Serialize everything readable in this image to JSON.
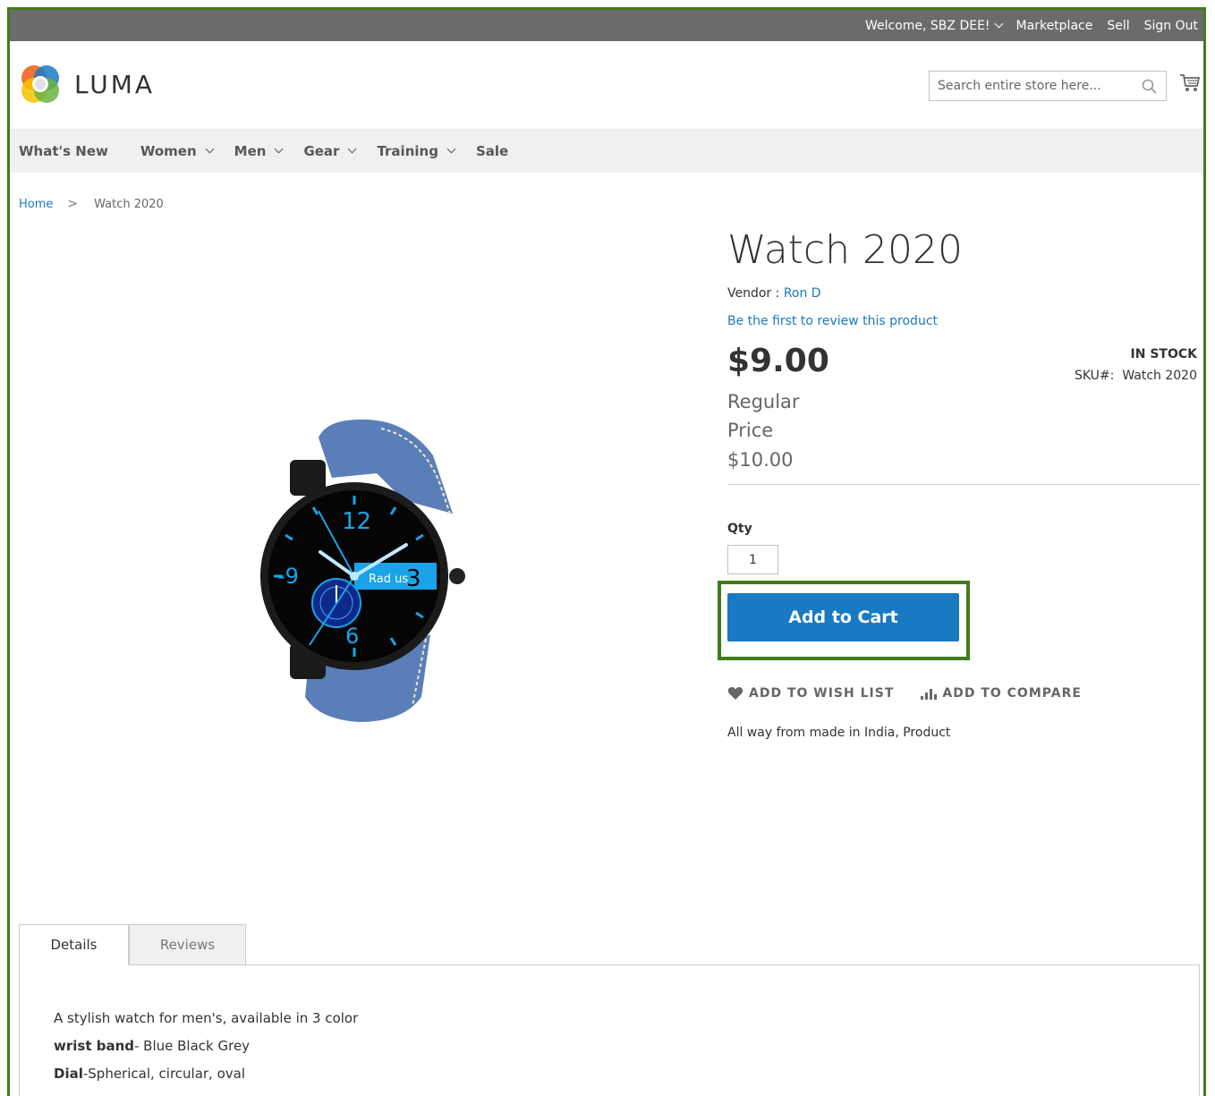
{
  "topbar": {
    "welcome": "Welcome, SBZ DEE!",
    "marketplace": "Marketplace",
    "sell": "Sell",
    "signout": "Sign Out"
  },
  "header": {
    "logo_text": "LUMA",
    "search_placeholder": "Search entire store here..."
  },
  "nav": [
    {
      "label": "What's New",
      "dropdown": false
    },
    {
      "label": "Women",
      "dropdown": true
    },
    {
      "label": "Men",
      "dropdown": true
    },
    {
      "label": "Gear",
      "dropdown": true
    },
    {
      "label": "Training",
      "dropdown": true
    },
    {
      "label": "Sale",
      "dropdown": false
    }
  ],
  "breadcrumb": {
    "home": "Home",
    "separator": ">",
    "current": "Watch 2020"
  },
  "product": {
    "title": "Watch 2020",
    "vendor_label": "Vendor : ",
    "vendor_name": "Ron D",
    "review_link": "Be the first to review this product",
    "price": "$9.00",
    "stock": "IN STOCK",
    "sku_label": "SKU#:",
    "sku_value": "Watch 2020",
    "regular_label": "Regular Price",
    "old_price": "$10.00",
    "qty_label": "Qty",
    "qty_value": "1",
    "add_to_cart": "Add to Cart",
    "wishlist": "ADD TO WISH LIST",
    "compare": "ADD TO COMPARE",
    "short_desc": "All way from made in India, Product"
  },
  "tabs": {
    "details": "Details",
    "reviews": "Reviews"
  },
  "details": {
    "line1": "A stylish watch for men's, available in 3 color",
    "band_label": "wrist band",
    "band_value": "- Blue Black Grey",
    "dial_label": "Dial",
    "dial_value": "-Spherical, circular, oval"
  },
  "watch_face": {
    "n12": "12",
    "n9": "-9",
    "n3": "3",
    "n6": "6",
    "brand": "Rad us"
  },
  "colors": {
    "accent": "#1979c3",
    "highlight": "#3f7d1a",
    "topbar": "#6b6b6b"
  }
}
